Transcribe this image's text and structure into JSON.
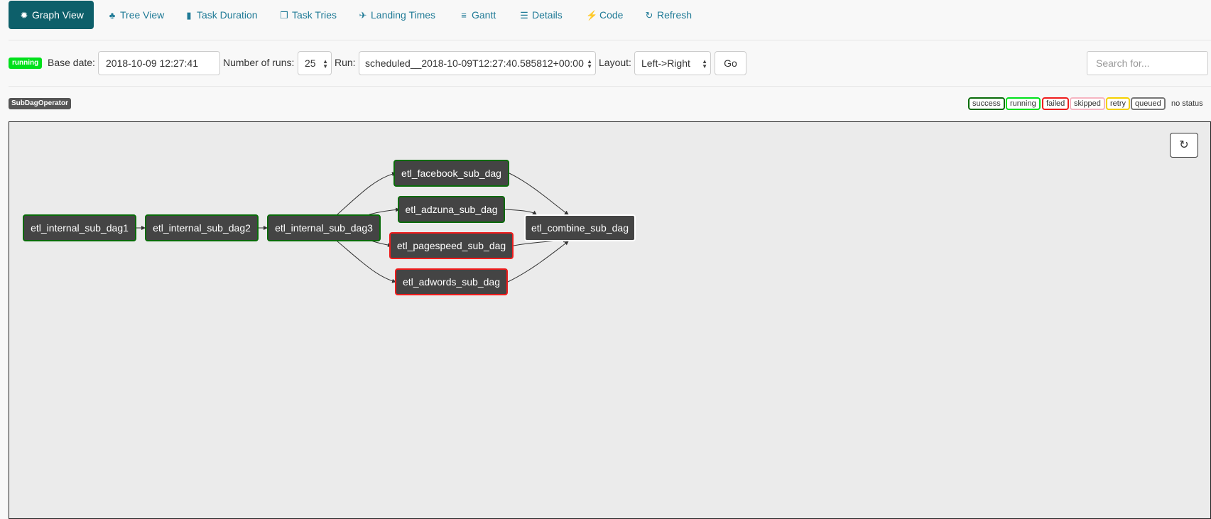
{
  "tabs": [
    {
      "label": "Graph View",
      "icon": "asterisk-icon"
    },
    {
      "label": "Tree View",
      "icon": "tree-icon"
    },
    {
      "label": "Task Duration",
      "icon": "bar-chart-icon"
    },
    {
      "label": "Task Tries",
      "icon": "files-icon"
    },
    {
      "label": "Landing Times",
      "icon": "plane-icon"
    },
    {
      "label": "Gantt",
      "icon": "align-left-icon"
    },
    {
      "label": "Details",
      "icon": "list-icon"
    },
    {
      "label": "Code",
      "icon": "flash-icon"
    },
    {
      "label": "Refresh",
      "icon": "refresh-icon"
    }
  ],
  "controls": {
    "state_badge": "running",
    "base_date_label": "Base date:",
    "base_date_value": "2018-10-09 12:27:41",
    "num_runs_label": "Number of runs:",
    "num_runs_value": "25",
    "run_label": "Run:",
    "run_value": "scheduled__2018-10-09T12:27:40.585812+00:00",
    "layout_label": "Layout:",
    "layout_value": "Left->Right",
    "go_label": "Go",
    "search_placeholder": "Search for..."
  },
  "operator_badge": "SubDagOperator",
  "legend": [
    {
      "label": "success",
      "color": "#096b09"
    },
    {
      "label": "running",
      "color": "#00e01b"
    },
    {
      "label": "failed",
      "color": "#ef1c1c"
    },
    {
      "label": "skipped",
      "color": "#f6b5c1"
    },
    {
      "label": "retry",
      "color": "#f5d000"
    },
    {
      "label": "queued",
      "color": "#777777"
    },
    {
      "label": "no status",
      "color": ""
    }
  ],
  "nodes": [
    {
      "label": "etl_internal_sub_dag1",
      "state": "success"
    },
    {
      "label": "etl_internal_sub_dag2",
      "state": "success"
    },
    {
      "label": "etl_internal_sub_dag3",
      "state": "success"
    },
    {
      "label": "etl_facebook_sub_dag",
      "state": "success"
    },
    {
      "label": "etl_adzuna_sub_dag",
      "state": "success"
    },
    {
      "label": "etl_pagespeed_sub_dag",
      "state": "failed"
    },
    {
      "label": "etl_adwords_sub_dag",
      "state": "failed"
    },
    {
      "label": "etl_combine_sub_dag",
      "state": "no status"
    }
  ],
  "edges": [
    [
      "etl_internal_sub_dag1",
      "etl_internal_sub_dag2"
    ],
    [
      "etl_internal_sub_dag2",
      "etl_internal_sub_dag3"
    ],
    [
      "etl_internal_sub_dag3",
      "etl_facebook_sub_dag"
    ],
    [
      "etl_internal_sub_dag3",
      "etl_adzuna_sub_dag"
    ],
    [
      "etl_internal_sub_dag3",
      "etl_pagespeed_sub_dag"
    ],
    [
      "etl_internal_sub_dag3",
      "etl_adwords_sub_dag"
    ],
    [
      "etl_facebook_sub_dag",
      "etl_combine_sub_dag"
    ],
    [
      "etl_adzuna_sub_dag",
      "etl_combine_sub_dag"
    ],
    [
      "etl_pagespeed_sub_dag",
      "etl_combine_sub_dag"
    ],
    [
      "etl_adwords_sub_dag",
      "etl_combine_sub_dag"
    ]
  ]
}
